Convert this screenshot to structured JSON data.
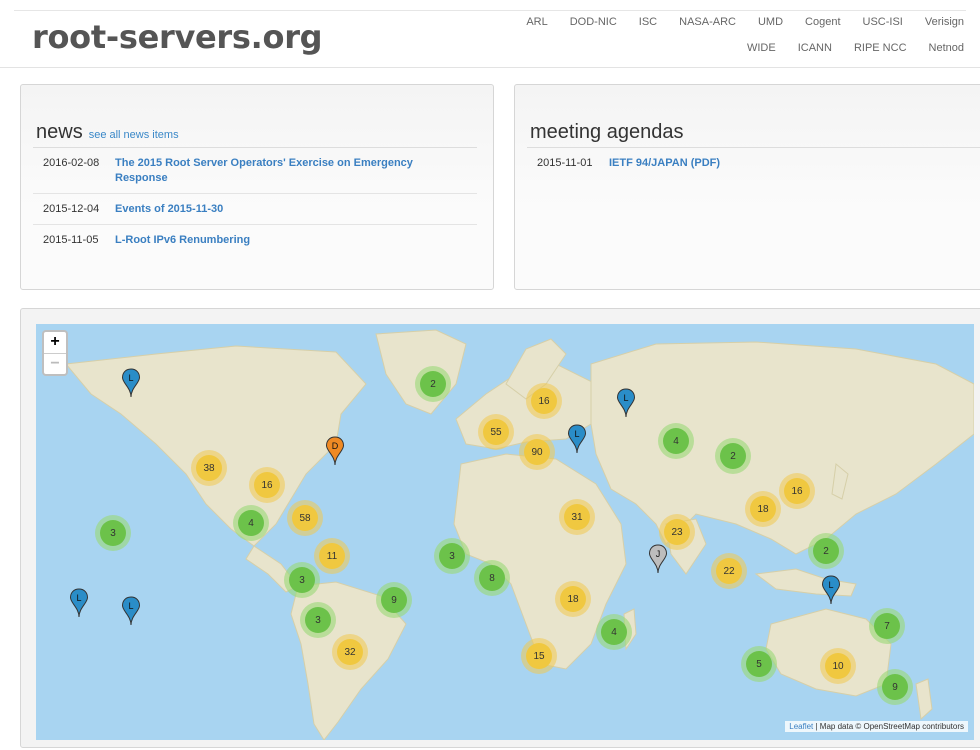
{
  "site": {
    "logo": "root-servers.org"
  },
  "nav": {
    "row1": [
      "ARL",
      "DOD-NIC",
      "ISC",
      "NASA-ARC",
      "UMD",
      "Cogent",
      "USC-ISI",
      "Verisign"
    ],
    "row2": [
      "WIDE",
      "ICANN",
      "RIPE NCC",
      "Netnod"
    ]
  },
  "news": {
    "title": "news",
    "more": "see all news items",
    "items": [
      {
        "date": "2016-02-08",
        "title": "The 2015 Root Server Operators' Exercise on Emergency Response"
      },
      {
        "date": "2015-12-04",
        "title": "Events of 2015-11-30"
      },
      {
        "date": "2015-11-05",
        "title": "L-Root IPv6 Renumbering"
      }
    ]
  },
  "meetings": {
    "title": "meeting agendas",
    "items": [
      {
        "date": "2015-11-01",
        "title": "IETF 94/JAPAN (PDF)"
      }
    ]
  },
  "map": {
    "zoom_in": "+",
    "zoom_out": "−",
    "attribution_link": "Leaflet",
    "attribution_text": " | Map data © OpenStreetMap contributors",
    "clusters": [
      {
        "count": "2",
        "color": "green"
      },
      {
        "count": "16",
        "color": "yellow"
      },
      {
        "count": "55",
        "color": "yellow"
      },
      {
        "count": "90",
        "color": "yellow"
      },
      {
        "count": "4",
        "color": "green"
      },
      {
        "count": "2",
        "color": "green"
      },
      {
        "count": "38",
        "color": "yellow"
      },
      {
        "count": "16",
        "color": "yellow"
      },
      {
        "count": "58",
        "color": "yellow"
      },
      {
        "count": "4",
        "color": "green"
      },
      {
        "count": "3",
        "color": "green"
      },
      {
        "count": "31",
        "color": "yellow"
      },
      {
        "count": "18",
        "color": "yellow"
      },
      {
        "count": "16",
        "color": "yellow"
      },
      {
        "count": "23",
        "color": "yellow"
      },
      {
        "count": "11",
        "color": "yellow"
      },
      {
        "count": "3",
        "color": "green"
      },
      {
        "count": "8",
        "color": "green"
      },
      {
        "count": "3",
        "color": "green"
      },
      {
        "count": "9",
        "color": "green"
      },
      {
        "count": "18",
        "color": "yellow"
      },
      {
        "count": "22",
        "color": "yellow"
      },
      {
        "count": "2",
        "color": "green"
      },
      {
        "count": "3",
        "color": "green"
      },
      {
        "count": "32",
        "color": "yellow"
      },
      {
        "count": "4",
        "color": "green"
      },
      {
        "count": "7",
        "color": "green"
      },
      {
        "count": "15",
        "color": "yellow"
      },
      {
        "count": "5",
        "color": "green"
      },
      {
        "count": "10",
        "color": "yellow"
      },
      {
        "count": "9",
        "color": "green"
      }
    ],
    "markers": [
      {
        "letter": "L",
        "color": "#2a8dc8"
      },
      {
        "letter": "L",
        "color": "#2a8dc8"
      },
      {
        "letter": "L",
        "color": "#2a8dc8"
      },
      {
        "letter": "D",
        "color": "#f08a24"
      },
      {
        "letter": "J",
        "color": "#bdbdbd"
      },
      {
        "letter": "L",
        "color": "#2a8dc8"
      },
      {
        "letter": "L",
        "color": "#2a8dc8"
      },
      {
        "letter": "L",
        "color": "#2a8dc8"
      }
    ]
  }
}
